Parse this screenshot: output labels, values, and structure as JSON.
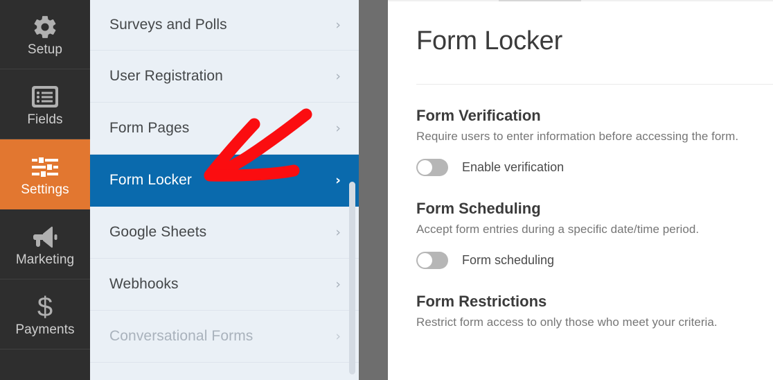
{
  "left_nav": {
    "items": [
      {
        "label": "Setup",
        "icon": "gear-icon",
        "active": false
      },
      {
        "label": "Fields",
        "icon": "form-list-icon",
        "active": false
      },
      {
        "label": "Settings",
        "icon": "sliders-icon",
        "active": true
      },
      {
        "label": "Marketing",
        "icon": "megaphone-icon",
        "active": false
      },
      {
        "label": "Payments",
        "icon": "dollar-icon",
        "active": false
      }
    ],
    "active_color": "#e27730",
    "background_color": "#2e2e2e"
  },
  "settings_panel": {
    "background_color": "#eaf0f6",
    "selected_color": "#0a6aad",
    "chevron_glyph": "›",
    "items": [
      {
        "label": "Surveys and Polls",
        "state": "normal"
      },
      {
        "label": "User Registration",
        "state": "normal"
      },
      {
        "label": "Form Pages",
        "state": "normal"
      },
      {
        "label": "Form Locker",
        "state": "selected"
      },
      {
        "label": "Google Sheets",
        "state": "normal"
      },
      {
        "label": "Webhooks",
        "state": "normal"
      },
      {
        "label": "Conversational Forms",
        "state": "disabled"
      }
    ]
  },
  "main": {
    "title": "Form Locker",
    "sections": [
      {
        "heading": "Form Verification",
        "description": "Require users to enter information before accessing the form.",
        "toggle": {
          "label": "Enable verification",
          "on": false
        }
      },
      {
        "heading": "Form Scheduling",
        "description": "Accept form entries during a specific date/time period.",
        "toggle": {
          "label": "Form scheduling",
          "on": false
        }
      },
      {
        "heading": "Form Restrictions",
        "description": "Restrict form access to only those who meet your criteria.",
        "toggle": null
      }
    ]
  },
  "annotation": {
    "type": "arrow",
    "color": "#fb0d10",
    "points_to": "Form Locker"
  }
}
